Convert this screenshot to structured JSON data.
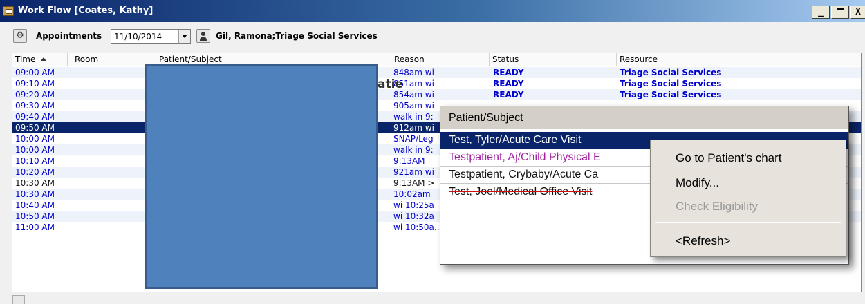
{
  "window": {
    "title": "Work Flow [Coates, Kathy]",
    "buttons": {
      "minimize": "_",
      "close": "X"
    }
  },
  "toolbar": {
    "appointments_label": "Appointments",
    "date_value": "11/10/2014",
    "resource_label": "Gil, Ramona;Triage Social Services"
  },
  "grid": {
    "columns": {
      "time": "Time",
      "room": "Room",
      "patient": "Patient/Subject",
      "reason": "Reason",
      "status": "Status",
      "resource": "Resource"
    },
    "rows": [
      {
        "time": "09:00 AM",
        "reason": "848am wi",
        "status": "READY",
        "resource": "Triage Social Services"
      },
      {
        "time": "09:10 AM",
        "reason": "851am wi",
        "status": "READY",
        "resource": "Triage Social Services"
      },
      {
        "time": "09:20 AM",
        "reason": "854am wi",
        "status": "READY",
        "resource": "Triage Social Services"
      },
      {
        "time": "09:30 AM",
        "reason": "905am wi",
        "status": "",
        "resource": ""
      },
      {
        "time": "09:40 AM",
        "reason": "walk in 9:",
        "status": "",
        "resource": ""
      },
      {
        "time": "09:50 AM",
        "reason": "912am wi",
        "status": "",
        "resource": ""
      },
      {
        "time": "10:00 AM",
        "reason": "SNAP/Leg",
        "status": "",
        "resource": ""
      },
      {
        "time": "10:00 AM",
        "reason": "walk in 9:",
        "status": "",
        "resource": ""
      },
      {
        "time": "10:10 AM",
        "reason": "9:13AM",
        "status": "",
        "resource": ""
      },
      {
        "time": "10:20 AM",
        "reason": "921am wi",
        "status": "",
        "resource": ""
      },
      {
        "time": "10:30 AM",
        "reason": "9:13AM >",
        "status": "",
        "resource": ""
      },
      {
        "time": "10:30 AM",
        "reason": "10:02am",
        "status": "",
        "resource": ""
      },
      {
        "time": "10:40 AM",
        "reason": "wi 10:25a",
        "status": "",
        "resource": ""
      },
      {
        "time": "10:50 AM",
        "reason": "wi 10:32a",
        "status": "",
        "resource": ""
      },
      {
        "time": "11:00 AM",
        "reason": "wi 10:50a...",
        "status": "",
        "resource": ""
      }
    ],
    "partial_text": {
      "a": "atie",
      "b": "atie"
    }
  },
  "popup": {
    "header": "Patient/Subject",
    "items": [
      "Test, Tyler/Acute Care Visit",
      "Testpatient, Aj/Child Physical E",
      "Testpatient, Crybaby/Acute Ca",
      "Test, Joel/Medical Office Visit"
    ]
  },
  "context_menu": {
    "items": [
      "Go to Patient's chart",
      "Modify...",
      "Check Eligibility",
      "<Refresh>"
    ]
  },
  "colors": {
    "row_text_blue": "#0000cc",
    "selection": "#0a246a",
    "redaction": "#4f81bd",
    "purple_item": "#a020a0"
  }
}
